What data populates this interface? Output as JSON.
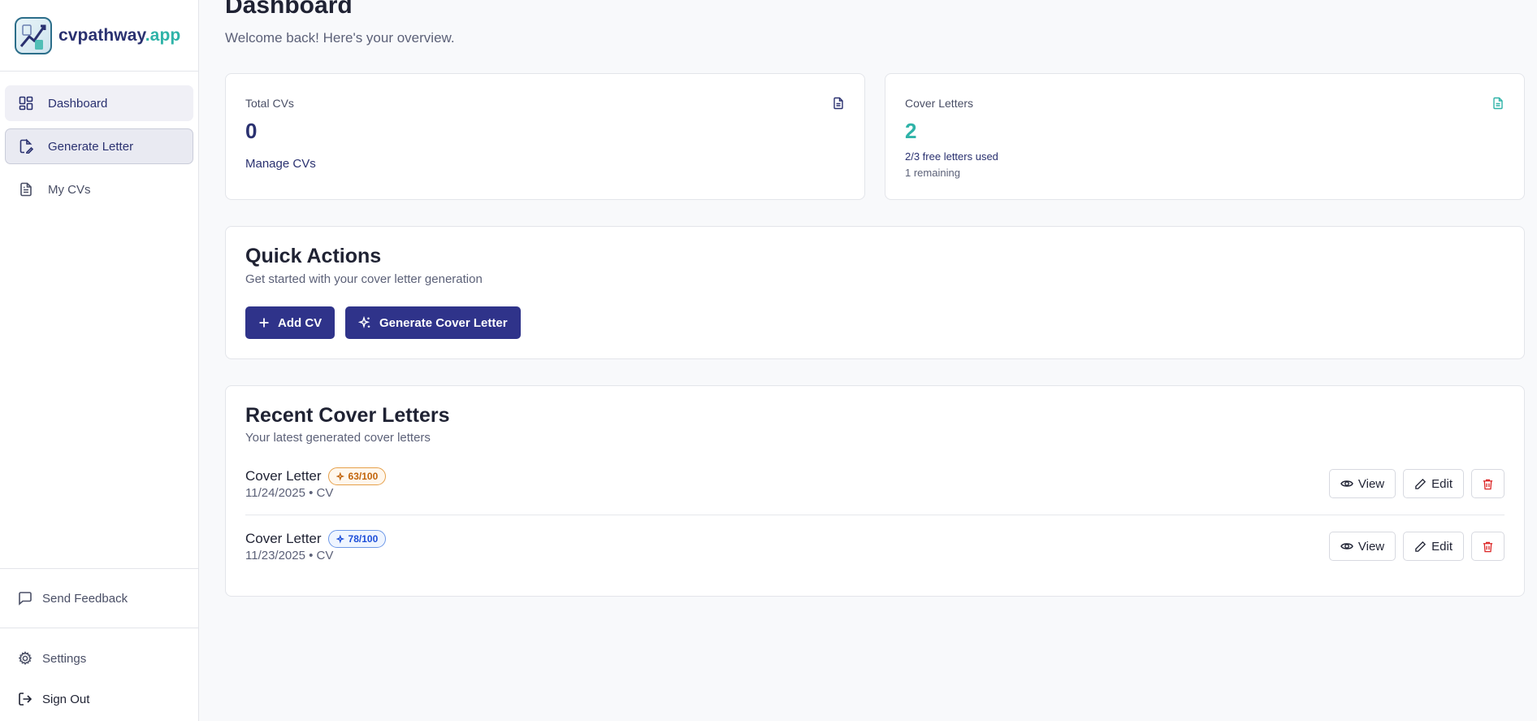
{
  "app": {
    "name_main": "cvpathway",
    "name_accent": ".app",
    "brand_color": "#2a3170",
    "accent_color": "#2fb3a8"
  },
  "sidebar": {
    "items": [
      {
        "label": "Dashboard",
        "icon": "grid-icon",
        "state": "active"
      },
      {
        "label": "Generate Letter",
        "icon": "document-pen-icon",
        "state": "hover"
      },
      {
        "label": "My CVs",
        "icon": "document-icon",
        "state": "normal"
      }
    ],
    "feedback_label": "Send Feedback",
    "settings_label": "Settings",
    "signout_label": "Sign Out"
  },
  "header": {
    "title": "Dashboard",
    "subtitle": "Welcome back! Here's your overview."
  },
  "stats": {
    "cvs": {
      "label": "Total CVs",
      "value": "0",
      "link": "Manage CVs",
      "value_color": "#2a3170"
    },
    "letters": {
      "label": "Cover Letters",
      "value": "2",
      "usage": "2/3 free letters used",
      "remaining": "1 remaining",
      "value_color": "#2fb3a8"
    }
  },
  "quick_actions": {
    "title": "Quick Actions",
    "subtitle": "Get started with your cover letter generation",
    "add_cv": "Add CV",
    "generate": "Generate Cover Letter"
  },
  "recent": {
    "title": "Recent Cover Letters",
    "subtitle": "Your latest generated cover letters",
    "view_label": "View",
    "edit_label": "Edit",
    "items": [
      {
        "title": "Cover Letter",
        "score": "63/100",
        "meta": "11/24/2025 • CV",
        "badge_color": "#d97706"
      },
      {
        "title": "Cover Letter",
        "score": "78/100",
        "meta": "11/23/2025 • CV",
        "badge_color": "#2563eb"
      }
    ]
  }
}
